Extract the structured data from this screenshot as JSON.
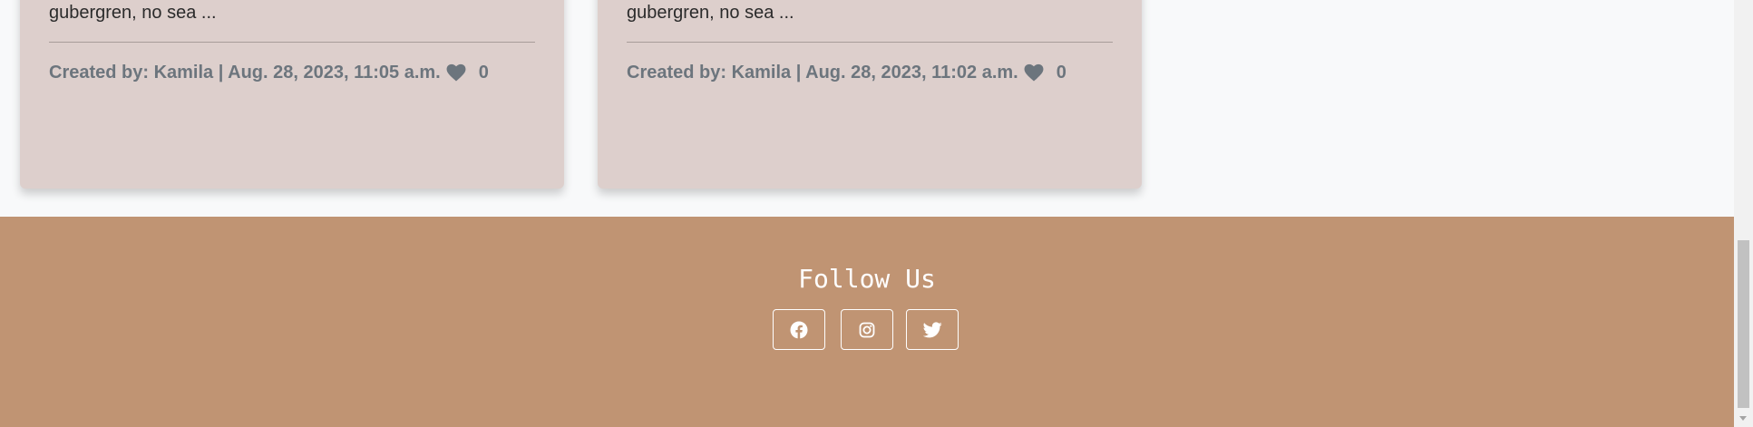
{
  "posts": [
    {
      "excerpt": "gubergren, no sea ...",
      "meta": "Created by: Kamila | Aug. 28, 2023, 11:05 a.m.",
      "likes": "0"
    },
    {
      "excerpt": "gubergren, no sea ...",
      "meta": "Created by: Kamila | Aug. 28, 2023, 11:02 a.m.",
      "likes": "0"
    }
  ],
  "footer": {
    "title": "Follow Us",
    "social": [
      {
        "icon": "facebook-icon"
      },
      {
        "icon": "instagram-icon"
      },
      {
        "icon": "twitter-icon"
      }
    ]
  },
  "colors": {
    "page_bg": "#f8f9fa",
    "card_bg": "#ddcfcc",
    "footer_bg": "#c09473",
    "meta_text": "#6c757d"
  }
}
